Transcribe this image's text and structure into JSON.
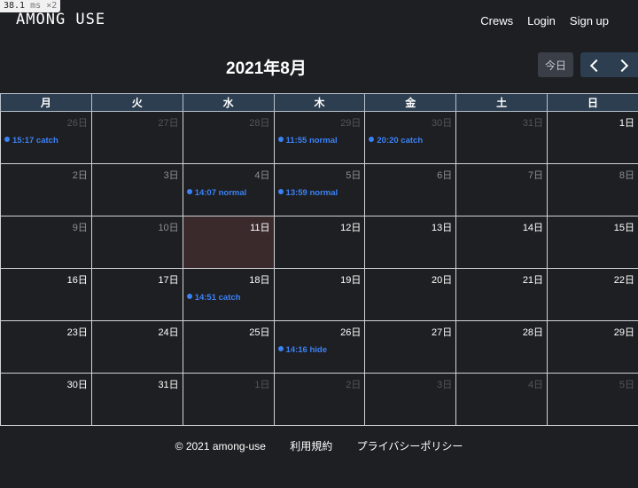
{
  "perf": {
    "value": "38.1",
    "unit": "ms",
    "mult": "×2"
  },
  "logo": "AMONG USE",
  "nav": {
    "crews": "Crews",
    "login": "Login",
    "signup": "Sign up"
  },
  "title": "2021年8月",
  "today_btn": "今日",
  "weekdays": [
    "月",
    "火",
    "水",
    "木",
    "金",
    "土",
    "日"
  ],
  "weeks": [
    [
      {
        "d": "26日",
        "other": true,
        "ev": "15:17 catch"
      },
      {
        "d": "27日",
        "other": true
      },
      {
        "d": "28日",
        "other": true
      },
      {
        "d": "29日",
        "other": true,
        "ev": "11:55 normal"
      },
      {
        "d": "30日",
        "other": true,
        "ev": "20:20 catch"
      },
      {
        "d": "31日",
        "other": true
      },
      {
        "d": "1日"
      }
    ],
    [
      {
        "d": "2日",
        "past": true
      },
      {
        "d": "3日",
        "past": true
      },
      {
        "d": "4日",
        "past": true,
        "ev": "14:07 normal"
      },
      {
        "d": "5日",
        "past": true,
        "ev": "13:59 normal"
      },
      {
        "d": "6日",
        "past": true
      },
      {
        "d": "7日",
        "past": true
      },
      {
        "d": "8日",
        "past": true
      }
    ],
    [
      {
        "d": "9日",
        "past": true
      },
      {
        "d": "10日",
        "past": true
      },
      {
        "d": "11日",
        "today": true
      },
      {
        "d": "12日"
      },
      {
        "d": "13日"
      },
      {
        "d": "14日"
      },
      {
        "d": "15日"
      }
    ],
    [
      {
        "d": "16日"
      },
      {
        "d": "17日"
      },
      {
        "d": "18日",
        "ev": "14:51 catch"
      },
      {
        "d": "19日"
      },
      {
        "d": "20日"
      },
      {
        "d": "21日"
      },
      {
        "d": "22日"
      }
    ],
    [
      {
        "d": "23日"
      },
      {
        "d": "24日"
      },
      {
        "d": "25日"
      },
      {
        "d": "26日",
        "ev": "14:16 hide"
      },
      {
        "d": "27日"
      },
      {
        "d": "28日"
      },
      {
        "d": "29日"
      }
    ],
    [
      {
        "d": "30日"
      },
      {
        "d": "31日"
      },
      {
        "d": "1日",
        "other": true
      },
      {
        "d": "2日",
        "other": true
      },
      {
        "d": "3日",
        "other": true
      },
      {
        "d": "4日",
        "other": true
      },
      {
        "d": "5日",
        "other": true
      }
    ]
  ],
  "footer": {
    "copyright": "© 2021 among-use",
    "terms": "利用規約",
    "privacy": "プライバシーポリシー"
  },
  "colors": {
    "accent": "#3b82f6",
    "header": "#2c3e50",
    "today_bg": "#3a2a2c"
  }
}
